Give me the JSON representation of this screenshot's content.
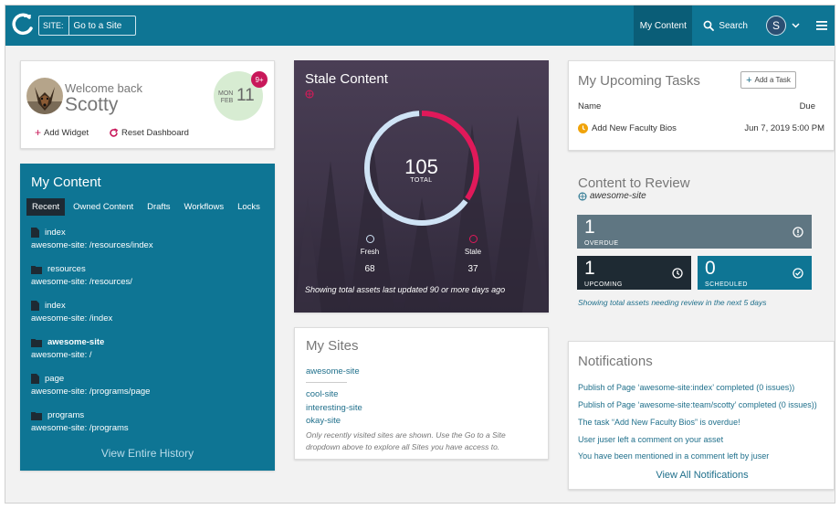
{
  "topbar": {
    "site_label": "SITE:",
    "site_placeholder": "Go to a Site",
    "my_content": "My Content",
    "search": "Search",
    "avatar_initial": "S",
    "colors": {
      "bar": "#0e7594",
      "active_tab": "#0a5d77"
    }
  },
  "welcome": {
    "greeting": "Welcome back",
    "name": "Scotty",
    "date_weekday": "MON",
    "date_month": "FEB",
    "date_day": "11",
    "badge": "9+",
    "add_widget": "Add Widget",
    "reset_dashboard": "Reset Dashboard"
  },
  "my_content": {
    "title": "My Content",
    "tabs": [
      {
        "label": "Recent",
        "active": true
      },
      {
        "label": "Owned Content",
        "active": false
      },
      {
        "label": "Drafts",
        "active": false
      },
      {
        "label": "Workflows",
        "active": false
      },
      {
        "label": "Locks",
        "active": false
      }
    ],
    "items": [
      {
        "name": "index",
        "path": "awesome-site: /resources/index",
        "icon": "file-icon"
      },
      {
        "name": "resources",
        "path": "awesome-site: /resources/",
        "icon": "folder-icon"
      },
      {
        "name": "index",
        "path": "awesome-site: /index",
        "icon": "file-icon"
      },
      {
        "name": "awesome-site",
        "path": "awesome-site: /",
        "icon": "folder-icon"
      },
      {
        "name": "page",
        "path": "awesome-site: /programs/page",
        "icon": "file-icon"
      },
      {
        "name": "programs",
        "path": "awesome-site: /programs",
        "icon": "folder-icon"
      }
    ],
    "view_history": "View Entire History"
  },
  "stale": {
    "title": "Stale Content",
    "total": "105",
    "total_label": "TOTAL",
    "fresh_label": "Fresh",
    "fresh_value": "68",
    "stale_label": "Stale",
    "stale_value": "37",
    "caption": "Showing total assets last updated 90 or more days ago",
    "colors": {
      "fresh": "#cfe3f5",
      "stale": "#e0195a"
    }
  },
  "sites": {
    "title": "My Sites",
    "items": [
      "awesome-site",
      "cool-site",
      "interesting-site",
      "okay-site"
    ],
    "note": "Only recently visited sites are shown. Use the Go to a Site dropdown above to explore all Sites you have access to."
  },
  "tasks": {
    "title": "My Upcoming Tasks",
    "add_task": "Add a Task",
    "col_name": "Name",
    "col_due": "Due",
    "rows": [
      {
        "name": "Add New Faculty Bios",
        "due": "Jun 7, 2019 5:00 PM"
      }
    ]
  },
  "review": {
    "title": "Content to Review",
    "site": "awesome-site",
    "overdue_count": "1",
    "overdue_label": "OVERDUE",
    "upcoming_count": "1",
    "upcoming_label": "UPCOMING",
    "scheduled_count": "0",
    "scheduled_label": "SCHEDULED",
    "note": "Showing total assets needing review in the next 5 days",
    "colors": {
      "overdue": "#5f7682",
      "upcoming": "#1e2a33",
      "scheduled": "#0e7594"
    }
  },
  "notifications": {
    "title": "Notifications",
    "items": [
      "Publish of Page ‘awesome-site:index’ completed (0 issues))",
      "Publish of Page ‘awesome-site:team/scotty’ completed (0 issues))",
      "The task “Add New Faculty Bios” is overdue!",
      "User juser left a comment on your asset",
      "You have been mentioned in a comment left by juser"
    ],
    "view_all": "View All Notifications"
  }
}
